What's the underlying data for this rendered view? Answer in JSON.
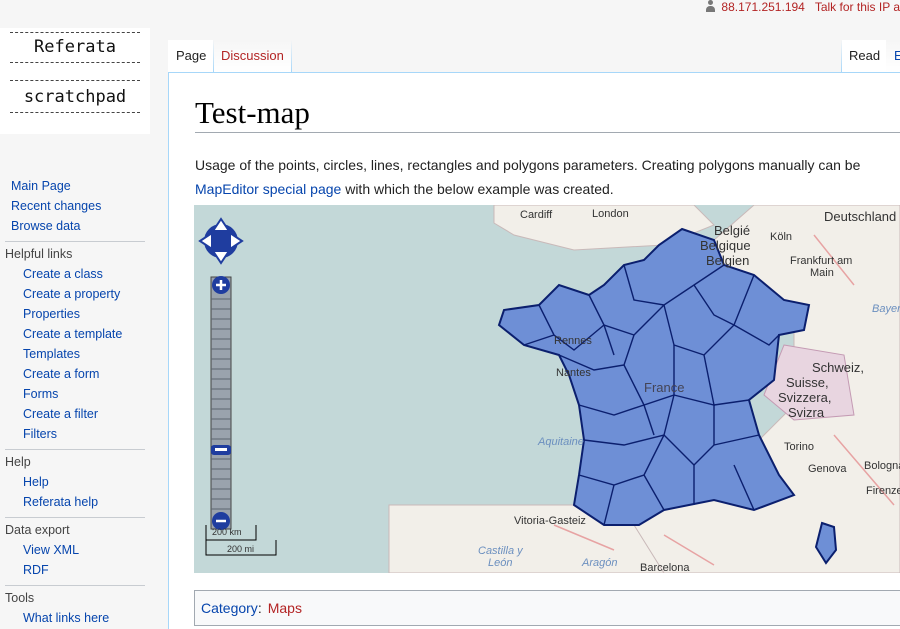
{
  "header": {
    "ip": "88.171.251.194",
    "talk_label": "Talk for this IP a"
  },
  "logo": {
    "line1": "Referata",
    "line2": "scratchpad"
  },
  "tabs": {
    "page": "Page",
    "discussion": "Discussion",
    "read": "Read",
    "edit_partial": "E"
  },
  "sidebar": {
    "main": [
      "Main Page",
      "Recent changes",
      "Browse data"
    ],
    "sections": [
      {
        "heading": "Helpful links",
        "items": [
          "Create a class",
          "Create a property",
          "Properties",
          "Create a template",
          "Templates",
          "Create a form",
          "Forms",
          "Create a filter",
          "Filters"
        ]
      },
      {
        "heading": "Help",
        "items": [
          "Help",
          "Referata help"
        ]
      },
      {
        "heading": "Data export",
        "items": [
          "View XML",
          "RDF"
        ]
      },
      {
        "heading": "Tools",
        "items": [
          "What links here"
        ]
      }
    ]
  },
  "page": {
    "title": "Test-map",
    "para_line1": "Usage of the points, circles, lines, rectangles and polygons parameters. Creating polygons manually can be",
    "para_link": "MapEditor special page",
    "para_line2_rest": " with which the below example was created."
  },
  "map": {
    "scale_km": "200 km",
    "scale_mi": "200 mi",
    "labels": [
      "Cardiff",
      "London",
      "Deutschland",
      "Belgié",
      "Belgique",
      "Belgien",
      "Köln",
      "Frankfurt am",
      "Main",
      "Rennes",
      "Nantes",
      "France",
      "Schweiz,",
      "Suisse,",
      "Svizzera,",
      "Svizra",
      "Torino",
      "Genova",
      "Bologna",
      "Firenze",
      "Vitoria-Gasteiz",
      "Castilla y",
      "León",
      "Aragón",
      "Barcelona",
      "Aquitaine",
      "Bayern"
    ],
    "fill_color": "#6e8fd6",
    "stroke_color": "#0b1f6e"
  },
  "category": {
    "label": "Category",
    "value": "Maps"
  }
}
